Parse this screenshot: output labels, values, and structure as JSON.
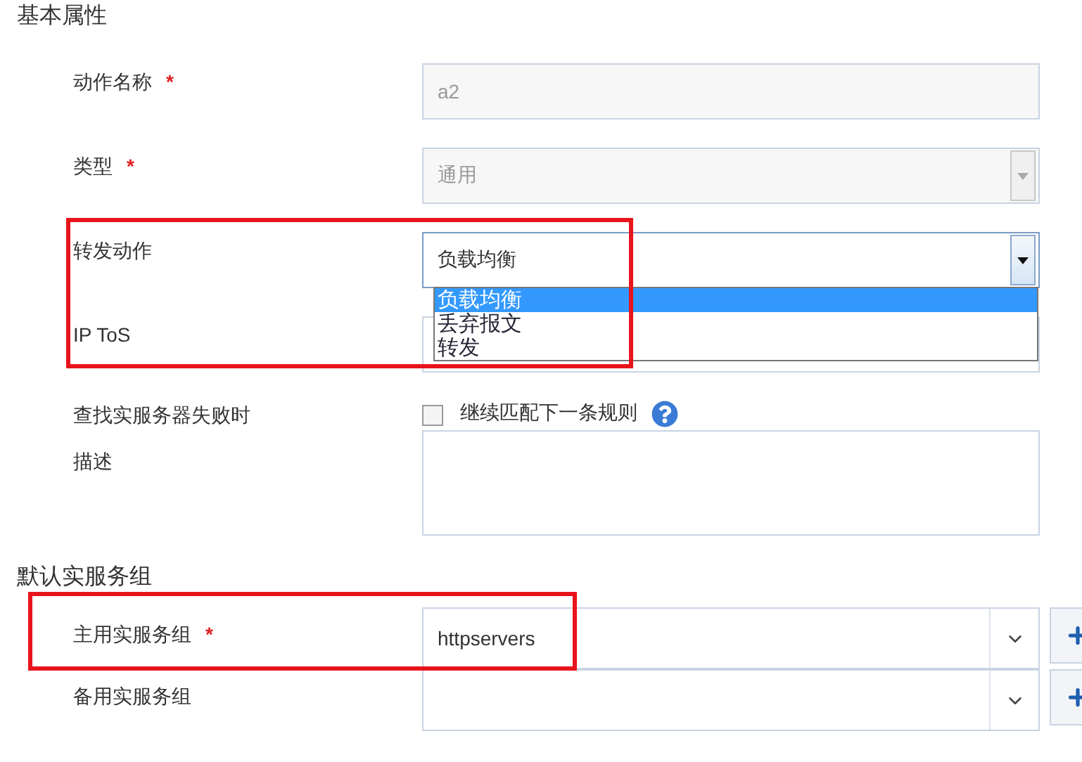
{
  "sections": [
    {
      "title": "基本属性",
      "fields": [
        {
          "kind": "text",
          "label": "动作名称",
          "required_mark": "*",
          "value": "a2",
          "disabled": true
        },
        {
          "kind": "select",
          "label": "类型",
          "required_mark": "*",
          "value": "通用",
          "disabled": true
        },
        {
          "kind": "select",
          "label": "转发动作",
          "value": "负载均衡",
          "disabled": false,
          "highlighted": true,
          "expanded": true,
          "options": [
            {
              "label": "负载均衡",
              "selected": true
            },
            {
              "label": "丢弃报文",
              "selected": false
            },
            {
              "label": "转发",
              "selected": false
            }
          ]
        },
        {
          "kind": "text",
          "label": "IP ToS"
        },
        {
          "kind": "checkbox",
          "label": "查找实服务器失败时",
          "text": "继续匹配下一条规则",
          "checked": false,
          "help": true
        },
        {
          "kind": "textarea",
          "label": "描述"
        }
      ]
    },
    {
      "title": "默认实服务组",
      "fields": [
        {
          "kind": "group",
          "label": "主用实服务组",
          "required_mark": "*",
          "value": "httpservers",
          "highlighted": true
        },
        {
          "kind": "group",
          "label": "备用实服务组"
        }
      ]
    }
  ]
}
